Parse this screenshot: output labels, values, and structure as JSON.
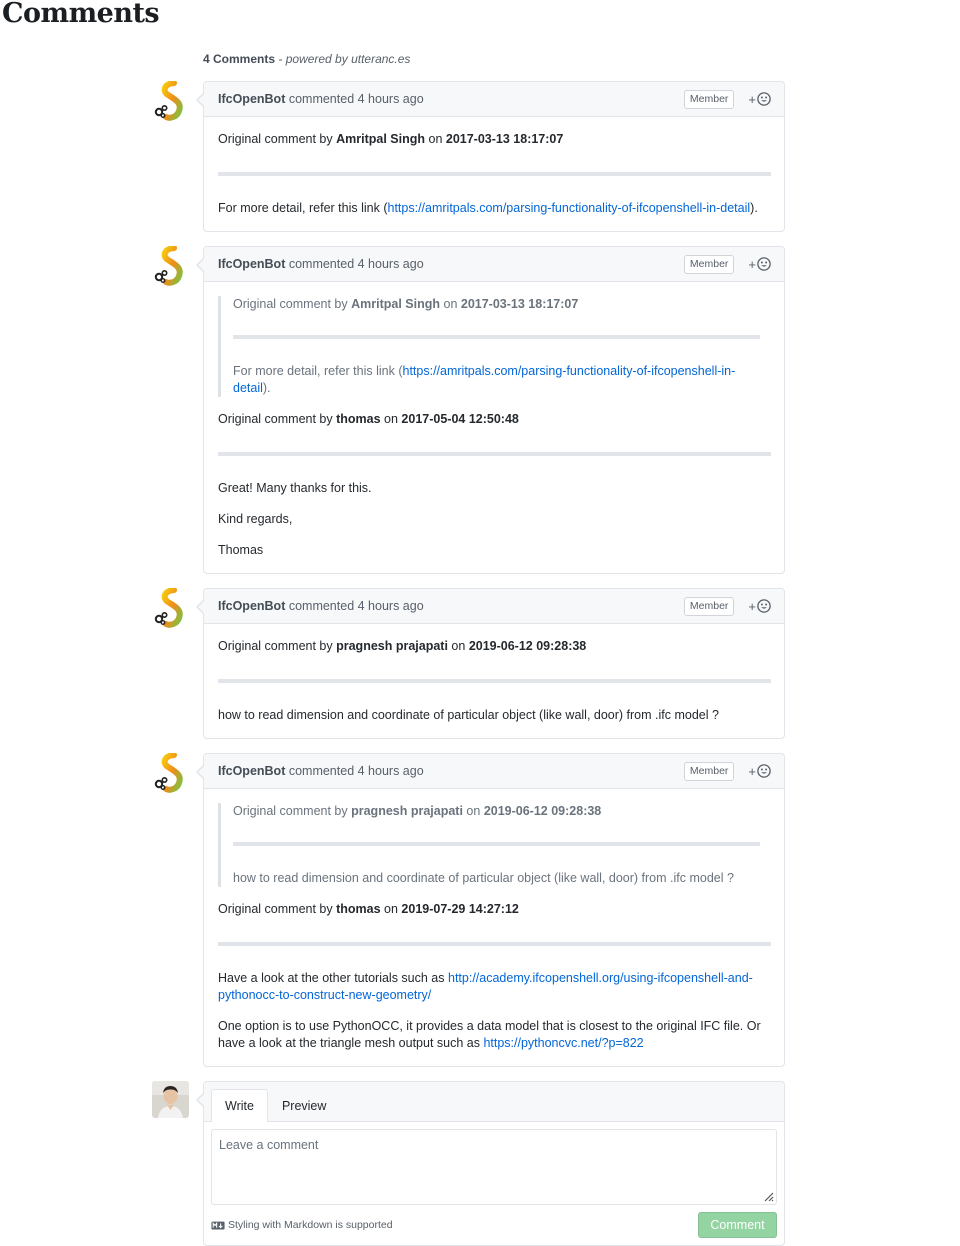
{
  "page": {
    "title": "Comments"
  },
  "meta": {
    "count_label": "4 Comments",
    "powered_by": " - powered by utteranc.es"
  },
  "comments": [
    {
      "author": "IfcOpenBot",
      "action": " commented ",
      "time": "4 hours ago",
      "badge": "Member",
      "reaction": "+",
      "body": {
        "intro_prefix": "Original comment by ",
        "intro_name": "Amritpal Singh",
        "intro_on": " on ",
        "intro_date": "2017-03-13 18:17:07",
        "text_prefix": "For more detail, refer this link (",
        "link": "https://amritpals.com/parsing-functionality-of-ifcopenshell-in-detail",
        "text_suffix": ")."
      }
    },
    {
      "author": "IfcOpenBot",
      "action": " commented ",
      "time": "4 hours ago",
      "badge": "Member",
      "reaction": "+",
      "quote": {
        "intro_prefix": "Original comment by ",
        "intro_name": "Amritpal Singh",
        "intro_on": " on ",
        "intro_date": "2017-03-13 18:17:07",
        "text_prefix": "For more detail, refer this link (",
        "link": "https://amritpals.com/parsing-functionality-of-ifcopenshell-in-detail",
        "text_suffix": ")."
      },
      "body": {
        "intro_prefix": "Original comment by ",
        "intro_name": "thomas",
        "intro_on": " on ",
        "intro_date": "2017-05-04 12:50:48",
        "p1": "Great! Many thanks for this.",
        "p2": "Kind regards,",
        "p3": "Thomas"
      }
    },
    {
      "author": "IfcOpenBot",
      "action": " commented ",
      "time": "4 hours ago",
      "badge": "Member",
      "reaction": "+",
      "body": {
        "intro_prefix": "Original comment by ",
        "intro_name": "pragnesh prajapati",
        "intro_on": " on ",
        "intro_date": "2019-06-12 09:28:38",
        "text": "how to read dimension and coordinate of particular object (like wall, door) from .ifc model ?"
      }
    },
    {
      "author": "IfcOpenBot",
      "action": " commented ",
      "time": "4 hours ago",
      "badge": "Member",
      "reaction": "+",
      "quote": {
        "intro_prefix": "Original comment by ",
        "intro_name": "pragnesh prajapati",
        "intro_on": " on ",
        "intro_date": "2019-06-12 09:28:38",
        "text": "how to read dimension and coordinate of particular object (like wall, door) from .ifc model ?"
      },
      "body": {
        "intro_prefix": "Original comment by ",
        "intro_name": "thomas",
        "intro_on": " on ",
        "intro_date": "2019-07-29 14:27:12",
        "p1_prefix": "Have a look at the other tutorials such as ",
        "p1_link": "http://academy.ifcopenshell.org/using-ifcopenshell-and-pythonocc-to-construct-new-geometry/",
        "p2_prefix": "One option is to use PythonOCC, it provides a data model that is closest to the original IFC file. Or have a look at the triangle mesh output such as ",
        "p2_link": "https://pythoncvc.net/?p=822"
      }
    }
  ],
  "form": {
    "tab_write": "Write",
    "tab_preview": "Preview",
    "placeholder": "Leave a comment",
    "markdown_note": "Styling with Markdown is supported",
    "submit_label": "Comment"
  },
  "icons": {
    "bot_avatar": "ifcopenbot-logo-icon",
    "reaction": "smiley-icon",
    "markdown": "markdown-icon",
    "resize": "resize-grip-icon"
  },
  "colors": {
    "link": "#0366d6",
    "submit_disabled": "#94d3a2",
    "header_bg": "#f6f8fa",
    "border": "#e1e4e8"
  }
}
